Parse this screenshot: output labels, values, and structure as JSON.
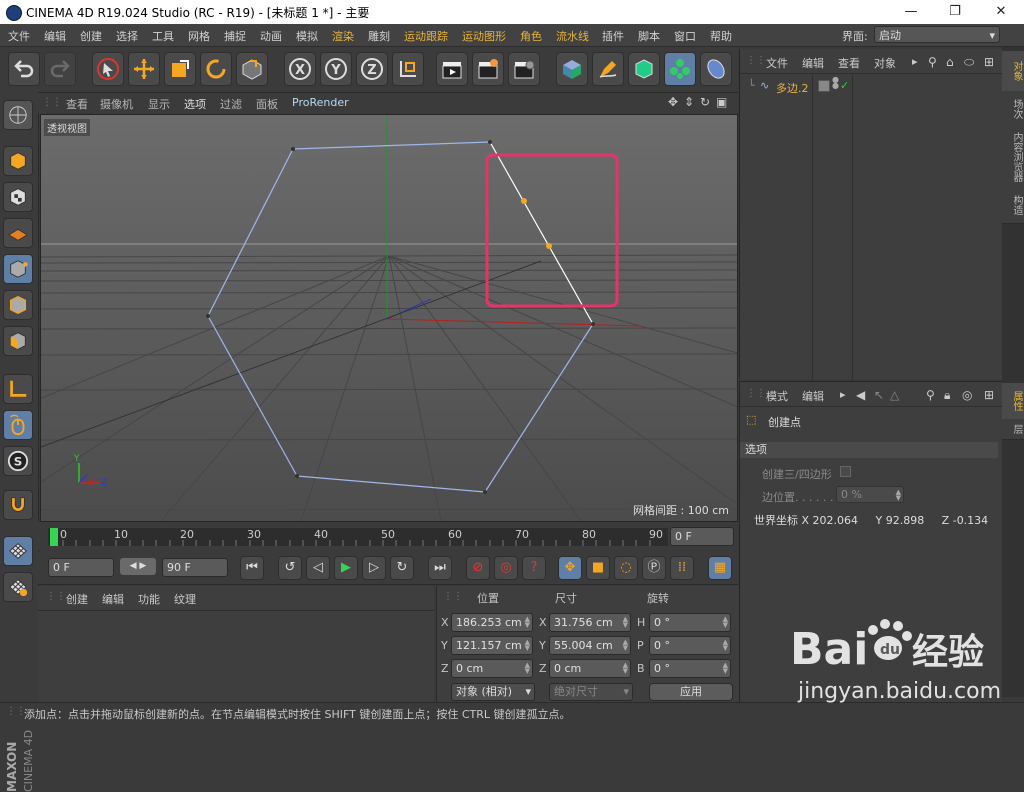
{
  "titlebar": {
    "title": "CINEMA 4D R19.024 Studio (RC - R19) - [未标题 1 *] - 主要",
    "minimize": "—",
    "maximize": "❐",
    "close": "✕"
  },
  "menu": {
    "items": [
      "文件",
      "编辑",
      "创建",
      "选择",
      "工具",
      "网格",
      "捕捉",
      "动画",
      "模拟",
      "渲染",
      "雕刻",
      "运动跟踪",
      "运动图形",
      "角色",
      "流水线",
      "插件",
      "脚本",
      "窗口",
      "帮助"
    ],
    "layout_label": "界面:",
    "layout_value": "启动"
  },
  "viewport": {
    "menus": [
      "查看",
      "摄像机",
      "显示",
      "选项",
      "过滤",
      "面板",
      "ProRender"
    ],
    "name": "透视视图",
    "grid_spacing": "网格间距 : 100 cm"
  },
  "timeline": {
    "ticks": [
      "0",
      "10",
      "20",
      "30",
      "40",
      "50",
      "60",
      "70",
      "80",
      "90"
    ],
    "current_frame": "0 F"
  },
  "transport": {
    "start_frame": "0 F",
    "end_frame": "90 F"
  },
  "materials": {
    "tabs": [
      "创建",
      "编辑",
      "功能",
      "纹理"
    ]
  },
  "coordinates": {
    "headers": [
      "位置",
      "尺寸",
      "旋转"
    ],
    "rows": [
      {
        "axis": "X",
        "pos": "186.253 cm",
        "size_axis": "X",
        "size": "31.756 cm",
        "rot_axis": "H",
        "rot": "0 °"
      },
      {
        "axis": "Y",
        "pos": "121.157 cm",
        "size_axis": "Y",
        "size": "55.004 cm",
        "rot_axis": "P",
        "rot": "0 °"
      },
      {
        "axis": "Z",
        "pos": "0 cm",
        "size_axis": "Z",
        "size": "0 cm",
        "rot_axis": "B",
        "rot": "0 °"
      }
    ],
    "mode": "对象 (相对)",
    "size_mode": "绝对尺寸",
    "apply": "应用"
  },
  "object_manager": {
    "menus": [
      "文件",
      "编辑",
      "查看",
      "对象"
    ],
    "object_name": "多边.2"
  },
  "right_tabs": [
    "对象",
    "场次",
    "内容浏览器",
    "构造"
  ],
  "attr_tabs": [
    "属性",
    "层"
  ],
  "attributes": {
    "menus": [
      "模式",
      "编辑"
    ],
    "tool_name": "创建点",
    "section": "选项",
    "create_tri_quad": "创建三/四边形",
    "edge_pos_label": "边位置. . . . . . . .",
    "edge_pos_value": "0 %",
    "world_coords": "世界坐标 X 202.064     Y 92.898     Z -0.134"
  },
  "status": "添加点：点击并拖动鼠标创建新的点。在节点编辑模式时按住 SHIFT 键创建面上点；按住 CTRL 键创建孤立点。",
  "watermark": {
    "text1": "Bai",
    "text2": "经验",
    "url": "jingyan.baidu.com"
  },
  "maxon": {
    "line1": "MAXON",
    "line2": "CINEMA 4D"
  },
  "colors": {
    "accent": "#e8b43c",
    "highlight_box": "#e8336a",
    "spline": "#9fb6ea",
    "selected_point": "#f5a623",
    "button_active": "#5f7fa6"
  }
}
